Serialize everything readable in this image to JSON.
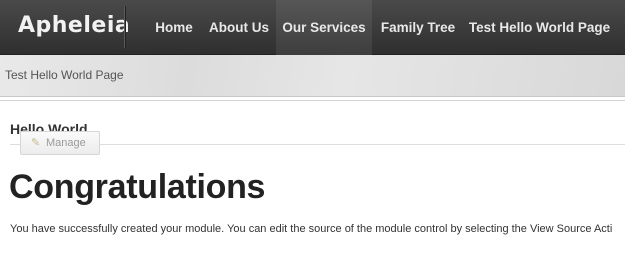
{
  "navbar": {
    "logo": "Apheleia",
    "items": [
      {
        "label": "Home"
      },
      {
        "label": "About Us"
      },
      {
        "label": "Our Services"
      },
      {
        "label": "Family Tree"
      },
      {
        "label": "Test Hello World Page"
      }
    ]
  },
  "breadcrumb": "Test Hello World Page",
  "module": {
    "title": "Hello World",
    "manage_label": "Manage",
    "heading": "Congratulations",
    "message": "You have successfully created your module. You can edit the source of the module control by selecting the View Source Acti"
  }
}
